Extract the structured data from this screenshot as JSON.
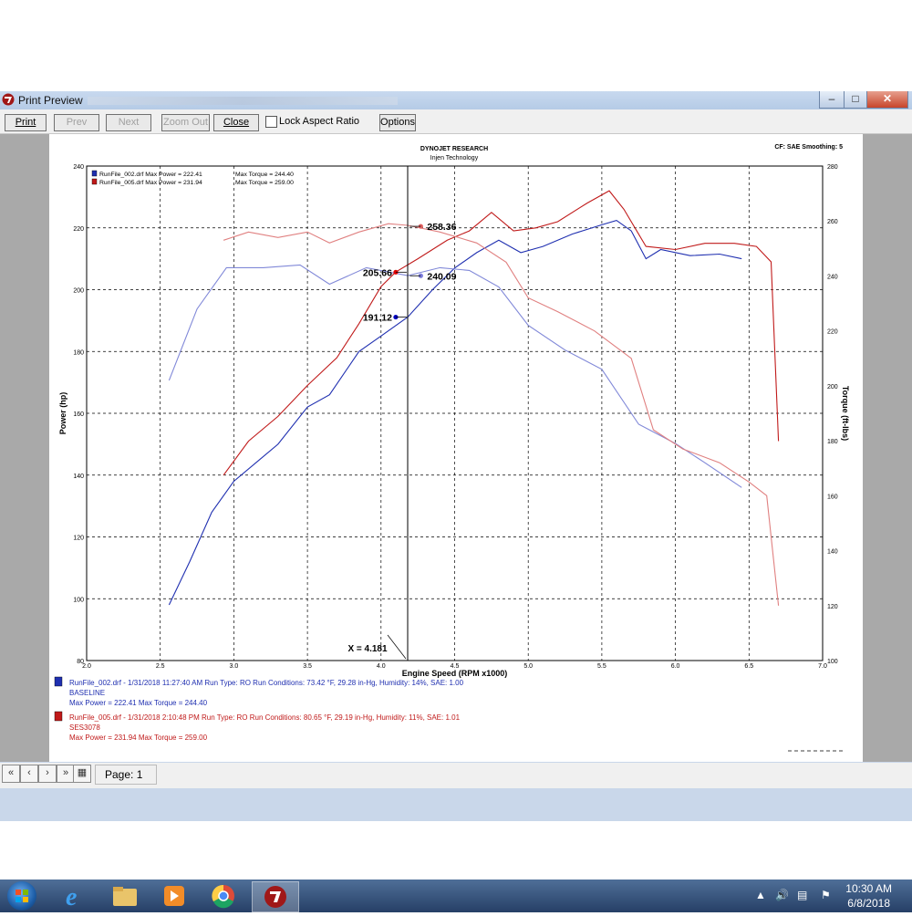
{
  "window": {
    "title": "Print Preview"
  },
  "toolbar": {
    "print": "Print",
    "prev": "Prev",
    "next": "Next",
    "zoom_out": "Zoom Out",
    "close": "Close",
    "lock_aspect": "Lock Aspect Ratio",
    "options": "Options"
  },
  "status": {
    "page": "Page: 1"
  },
  "taskbar": {
    "time": "10:30 AM",
    "date": "6/8/2018"
  },
  "header": {
    "title": "DYNOJET RESEARCH",
    "subtitle": "Injen Technology",
    "cf": "CF: SAE  Smoothing: 5"
  },
  "legend": [
    {
      "file": "RunFile_002.drf",
      "max_power_label": "Max Power = 222.41",
      "max_torque_label": "Max Torque = 244.40",
      "color": "#1f2fb0"
    },
    {
      "file": "RunFile_005.drf",
      "max_power_label": "Max Power = 231.94",
      "max_torque_label": "Max Torque = 259.00",
      "color": "#c01a1a"
    }
  ],
  "runs": [
    {
      "line1": "RunFile_002.drf - 1/31/2018 11:27:40 AM  Run Type: RO  Run Conditions: 73.42 °F, 29.28 in-Hg,  Humidity:  14%, SAE: 1.00",
      "line2": "BASELINE",
      "line3": "Max Power = 222.41  Max Torque = 244.40",
      "color": "#1f2fb0"
    },
    {
      "line1": "RunFile_005.drf - 1/31/2018 2:10:48 PM  Run Type: RO  Run Conditions: 80.65 °F, 29.19 in-Hg,  Humidity:  11%, SAE: 1.01",
      "line2": "SES3078",
      "line3": "Max Power = 231.94  Max Torque = 259.00",
      "color": "#c01a1a"
    }
  ],
  "chart_data": {
    "type": "line",
    "xlabel": "Engine Speed (RPM x1000)",
    "ylabel": "Power (hp)",
    "y2label": "Torque (ft-lbs)",
    "xlim": [
      2.0,
      7.0
    ],
    "ylim": [
      80,
      240
    ],
    "y2lim": [
      100,
      280
    ],
    "x_ticks": [
      "2.0",
      "2.5",
      "3.0",
      "3.5",
      "4.0",
      "4.5",
      "5.0",
      "5.5",
      "6.0",
      "6.5",
      "7.0"
    ],
    "y_ticks": [
      "80",
      "100",
      "120",
      "140",
      "160",
      "180",
      "200",
      "220",
      "240"
    ],
    "y2_ticks": [
      "100",
      "120",
      "140",
      "160",
      "180",
      "200",
      "220",
      "240",
      "260",
      "280"
    ],
    "cursor": {
      "x": 4.181,
      "label": "X = 4.181"
    },
    "annotations": [
      {
        "text": "258.36",
        "x": 4.27,
        "y": 220.5,
        "color": "#e06060"
      },
      {
        "text": "205.66",
        "x": 4.1,
        "y": 205.66,
        "color": "#e00000"
      },
      {
        "text": "240.09",
        "x": 4.27,
        "y": 204.5,
        "color": "#8080e0"
      },
      {
        "text": "191.12",
        "x": 4.1,
        "y": 191.12,
        "color": "#0000c0"
      }
    ],
    "series": [
      {
        "name": "RunFile_002.drf",
        "quantity": "power",
        "axis": "left",
        "color": "#1f2fb0",
        "x": [
          2.56,
          2.7,
          2.85,
          3.0,
          3.15,
          3.3,
          3.5,
          3.65,
          3.85,
          4.0,
          4.181,
          4.35,
          4.5,
          4.65,
          4.8,
          4.95,
          5.1,
          5.3,
          5.5,
          5.6,
          5.7,
          5.8,
          5.9,
          6.1,
          6.3,
          6.45
        ],
        "y": [
          98,
          112,
          128,
          138,
          144,
          150,
          162,
          166,
          180,
          185,
          191.1,
          200,
          207,
          212,
          216,
          212,
          214,
          218,
          221,
          222.4,
          219,
          210,
          213,
          211,
          211.5,
          210
        ]
      },
      {
        "name": "RunFile_005.drf",
        "quantity": "power",
        "axis": "left",
        "color": "#c01a1a",
        "x": [
          2.93,
          3.1,
          3.3,
          3.5,
          3.7,
          3.85,
          4.0,
          4.1,
          4.25,
          4.45,
          4.6,
          4.75,
          4.9,
          5.05,
          5.2,
          5.4,
          5.55,
          5.65,
          5.8,
          6.0,
          6.2,
          6.4,
          6.55,
          6.65,
          6.7
        ],
        "y": [
          140,
          151,
          159,
          169,
          178,
          189,
          201,
          205.7,
          210,
          216,
          219,
          225,
          219,
          220,
          222,
          228,
          232,
          226,
          214,
          213,
          215,
          215,
          214,
          209,
          151
        ]
      },
      {
        "name": "RunFile_002.drf",
        "quantity": "torque",
        "axis": "right",
        "color": "#8088d8",
        "x": [
          2.56,
          2.75,
          2.95,
          3.2,
          3.45,
          3.65,
          3.9,
          4.181,
          4.4,
          4.6,
          4.8,
          5.0,
          5.25,
          5.5,
          5.75,
          6.0,
          6.2,
          6.45
        ],
        "y": [
          202,
          228,
          243,
          243,
          244,
          237,
          243,
          240.1,
          243,
          242,
          236,
          222,
          213,
          206,
          186,
          179,
          172,
          163
        ]
      },
      {
        "name": "RunFile_005.drf",
        "quantity": "torque",
        "axis": "right",
        "color": "#e08080",
        "x": [
          2.93,
          3.1,
          3.3,
          3.5,
          3.65,
          3.85,
          4.05,
          4.181,
          4.4,
          4.65,
          4.85,
          5.0,
          5.2,
          5.45,
          5.7,
          5.85,
          6.05,
          6.3,
          6.5,
          6.62,
          6.7
        ],
        "y": [
          253,
          256,
          254,
          256,
          252,
          256,
          259,
          258.4,
          256,
          252,
          245,
          232,
          227,
          220,
          210,
          184,
          177,
          172,
          165,
          160,
          120
        ]
      }
    ]
  }
}
